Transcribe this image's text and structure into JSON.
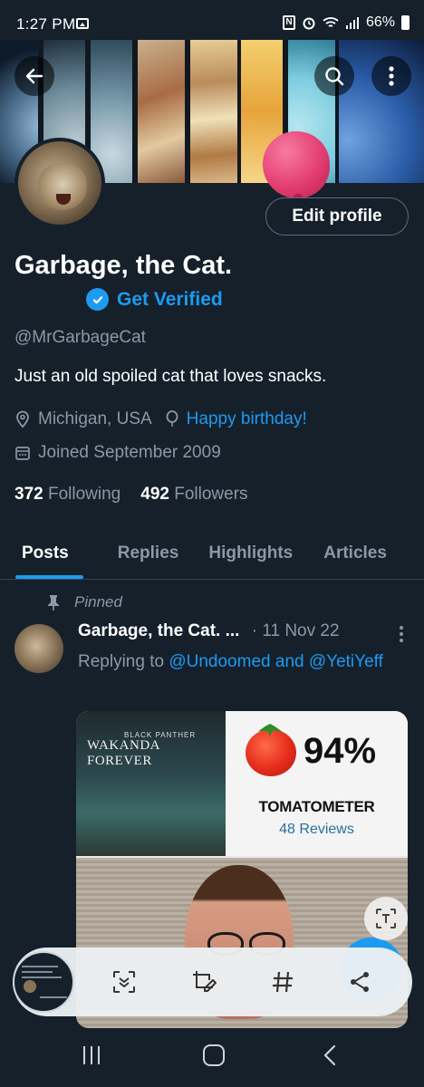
{
  "status_bar": {
    "time": "1:27 PM",
    "battery": "66%"
  },
  "profile": {
    "display_name": "Garbage, the Cat.",
    "get_verified": "Get Verified",
    "handle": "@MrGarbageCat",
    "bio": "Just an old spoiled cat that loves snacks.",
    "location": "Michigan, USA",
    "birthday": "Happy birthday!",
    "joined": "Joined September 2009",
    "following_count": "372",
    "following_label": "Following",
    "followers_count": "492",
    "followers_label": "Followers",
    "edit_profile": "Edit profile"
  },
  "tabs": [
    {
      "label": "Posts"
    },
    {
      "label": "Replies"
    },
    {
      "label": "Highlights"
    },
    {
      "label": "Articles"
    }
  ],
  "post": {
    "pinned_label": "Pinned",
    "author": "Garbage, the Cat. ...",
    "date": "· 11 Nov 22",
    "replying_to": "Replying to",
    "mention_1": "@Undoomed",
    "and": "and",
    "mention_2": "@YetiYeff",
    "image": {
      "poster_top": "BLACK PANTHER",
      "poster_title": "WAKANDA FOREVER",
      "score": "94%",
      "meter_label": "TOMATOMETER",
      "reviews": "48 Reviews"
    }
  },
  "colors": {
    "accent": "#1d9bf0",
    "background": "#15202b",
    "secondary_text": "#8b98a5"
  },
  "icons": [
    "back-arrow-icon",
    "search-icon",
    "more-vertical-icon",
    "verified-badge-icon",
    "location-pin-icon",
    "balloon-icon",
    "calendar-icon",
    "pin-icon",
    "text-scan-icon",
    "scroll-capture-icon",
    "crop-edit-icon",
    "hashtag-icon",
    "share-icon"
  ]
}
